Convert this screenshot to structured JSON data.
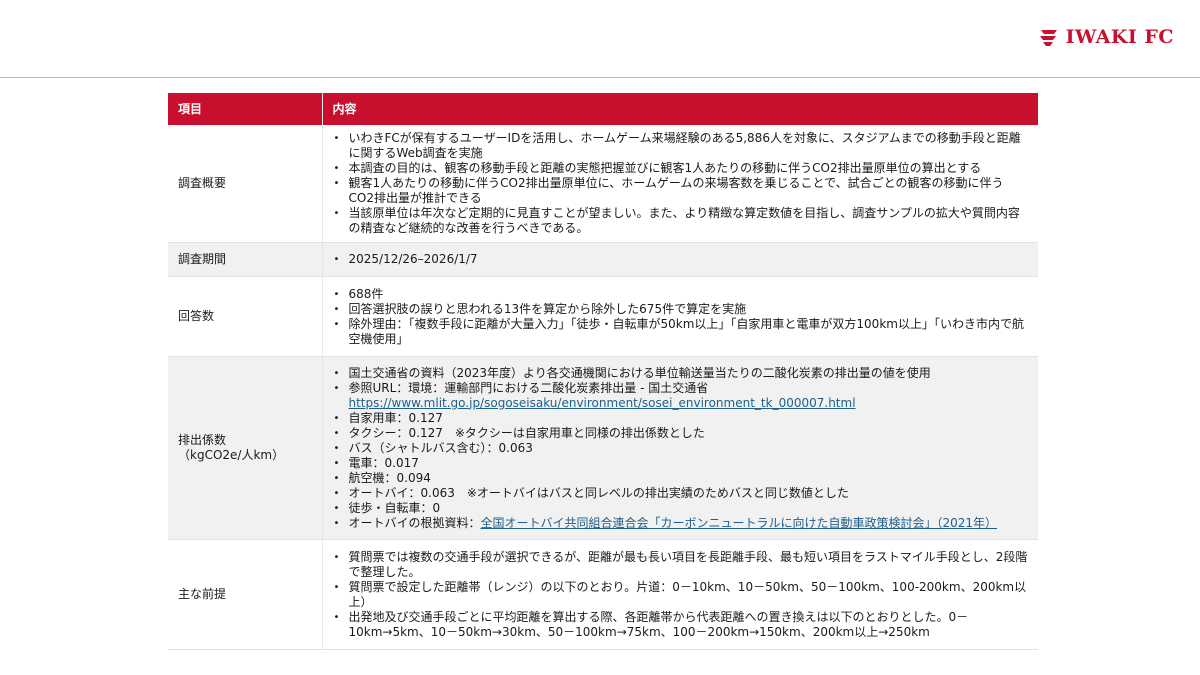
{
  "header": {
    "brand": "IWAKI FC"
  },
  "table": {
    "headers": [
      "項目",
      "内容"
    ],
    "rows": [
      {
        "label": [
          "調査概要"
        ],
        "items": [
          "いわきFCが保有するユーザーIDを活用し、ホームゲーム来場経験のある5,886人を対象に、スタジアムまでの移動手段と距離に関するWeb調査を実施",
          "本調査の目的は、観客の移動手段と距離の実態把握並びに観客1人あたりの移動に伴うCO2排出量原単位の算出とする",
          "観客1人あたりの移動に伴うCO2排出量原単位に、ホームゲームの来場客数を乗じることで、試合ごとの観客の移動に伴うCO2排出量が推計できる",
          "当該原単位は年次など定期的に見直すことが望ましい。また、より精緻な算定数値を目指し、調査サンプルの拡大や質問内容の精査など継続的な改善を行うべきである。"
        ]
      },
      {
        "label": [
          "調査期間"
        ],
        "items": [
          "2025/12/26–2026/1/7"
        ]
      },
      {
        "label": [
          "回答数"
        ],
        "items": [
          "688件",
          "回答選択肢の誤りと思われる13件を算定から除外した675件で算定を実施",
          "除外理由：「複数手段に距離が大量入力」「徒歩・自転車が50km以上」「自家用車と電車が双方100km以上」「いわき市内で航空機使用」"
        ]
      },
      {
        "label": [
          "排出係数",
          "（kgCO2e/人km）"
        ],
        "items": [
          "国土交通省の資料（2023年度）より各交通機関における単位輸送量当たりの二酸化炭素の排出量の値を使用",
          "参照URL：環境：運輸部門における二酸化炭素排出量 - 国土交通省",
          "自家用車：0.127",
          "タクシー：0.127　※タクシーは自家用車と同様の排出係数とした",
          "バス（シャトルバス含む）：0.063",
          "電車：0.017",
          "航空機：0.094",
          "オートバイ：0.063　※オートバイはバスと同レベルの排出実績のためバスと同じ数値とした",
          "徒歩・自転車：0",
          "オートバイの根拠資料："
        ],
        "url": "https://www.mlit.go.jp/sogoseisaku/environment/sosei_environment_tk_000007.html",
        "source_link": "全国オートバイ共同組合連合会「カーボンニュートラルに向けた自動車政策検討会」（2021年）"
      },
      {
        "label": [
          "主な前提"
        ],
        "items": [
          "質問票では複数の交通手段が選択できるが、距離が最も長い項目を長距離手段、最も短い項目をラストマイル手段とし、2段階で整理した。",
          "質問票で設定した距離帯（レンジ）の以下のとおり。片道：0－10km、10－50km、50－100km、100-200km、200km以上）",
          "出発地及び交通手段ごとに平均距離を算出する際、各距離帯から代表距離への置き換えは以下のとおりとした。0－10km→5km、10－50km→30km、50－100km→75km、100－200km→150km、200km以上→250km"
        ]
      }
    ]
  },
  "colors": {
    "accent": "#c8102e",
    "link": "#1f5f8a",
    "shade": "#f1f1f1"
  }
}
